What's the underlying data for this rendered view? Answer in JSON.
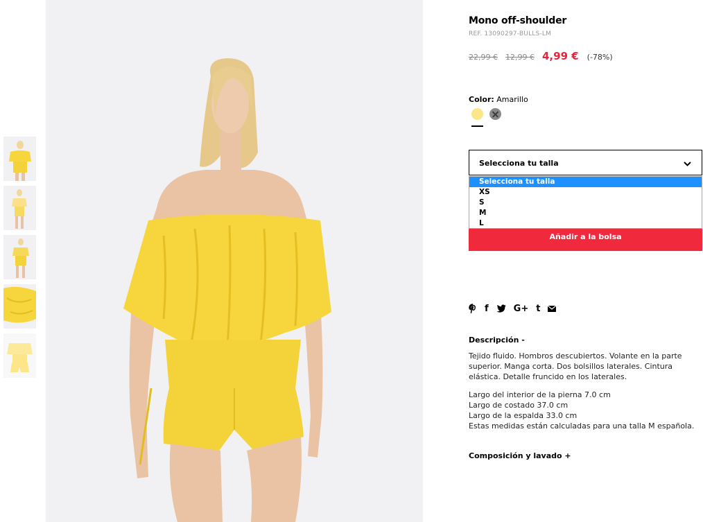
{
  "product": {
    "title": "Mono off-shoulder",
    "ref": "REF. 13090297-BULLS-LM",
    "old_prices": [
      "22,99 €",
      "12,99 €"
    ],
    "sale_price": "4,99 €",
    "discount": "(-78%)"
  },
  "color": {
    "label": "Color:",
    "value": "Amarillo",
    "swatches": [
      {
        "name": "Amarillo",
        "hex": "#fbe68a",
        "selected": true
      },
      {
        "name": "Gris",
        "hex": "#8a8a8a",
        "selected": false
      }
    ]
  },
  "size_select": {
    "selected": "Selecciona tu talla",
    "options": [
      "Selecciona tu talla",
      "XS",
      "S",
      "M",
      "L"
    ]
  },
  "add_to_bag_label": "Añadir a la bolsa",
  "share": {
    "icons": [
      "pinterest-icon",
      "facebook-icon",
      "twitter-icon",
      "google-plus-icon",
      "tumblr-icon",
      "email-icon"
    ],
    "google_plus_label": "G+",
    "facebook_label": "f",
    "tumblr_label": "t"
  },
  "description": {
    "title": "Descripción -",
    "text": "Tejido fluido. Hombros descubiertos. Volante en la parte superior. Manga corta. Dos bolsillos laterales. Cintura elástica. Detalle fruncido en los laterales.",
    "measures": [
      "Largo del interior de la pierna 7.0 cm",
      "Largo de costado 37.0 cm",
      "Largo de la espalda 33.0 cm",
      "Estas medidas están calculadas para una talla M española."
    ]
  },
  "composition_title": "Composición y lavado +",
  "colors": {
    "accent_red": "#e6233a",
    "button_red": "#f1293c",
    "dropdown_highlight": "#1e90ff",
    "garment_yellow": "#f6d63c"
  }
}
